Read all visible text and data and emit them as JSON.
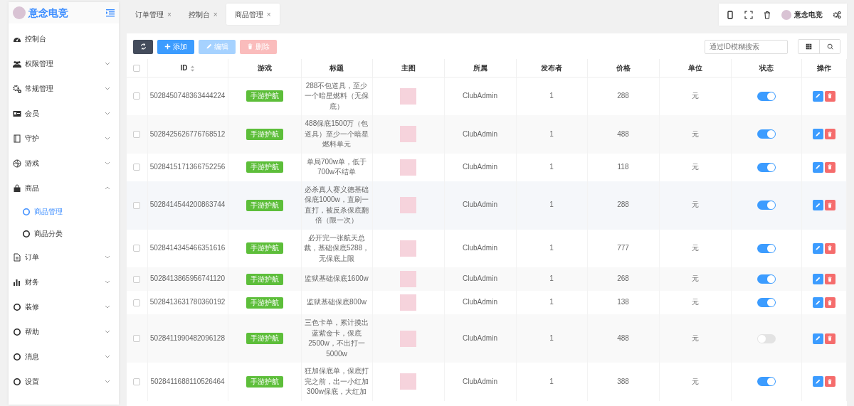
{
  "sidebar": {
    "logo": "意念电竞",
    "items": [
      {
        "label": "控制台"
      },
      {
        "label": "权限管理",
        "expanded": false
      },
      {
        "label": "常规管理",
        "expanded": false
      },
      {
        "label": "会员",
        "expanded": false
      },
      {
        "label": "守护",
        "expanded": false
      },
      {
        "label": "游戏",
        "expanded": false
      },
      {
        "label": "商品",
        "expanded": true,
        "children": [
          {
            "label": "商品管理",
            "selected": true
          },
          {
            "label": "商品分类",
            "selected": false
          }
        ]
      },
      {
        "label": "订单",
        "expanded": false
      },
      {
        "label": "财务",
        "expanded": false
      },
      {
        "label": "装修",
        "expanded": false
      },
      {
        "label": "帮助",
        "expanded": false
      },
      {
        "label": "消息",
        "expanded": false
      },
      {
        "label": "设置",
        "expanded": false
      }
    ]
  },
  "tabs": [
    {
      "label": "订单管理",
      "close": "×",
      "selected": false
    },
    {
      "label": "控制台",
      "close": "×",
      "selected": false
    },
    {
      "label": "商品管理",
      "close": "×",
      "selected": true
    }
  ],
  "header": {
    "user": "意念电竞"
  },
  "toolbar": {
    "buttons": [
      {
        "kind": "refresh",
        "disabled": false
      },
      {
        "kind": "add",
        "label": "添加",
        "disabled": false
      },
      {
        "kind": "edit",
        "label": "编辑",
        "disabled": true
      },
      {
        "kind": "delete",
        "label": "删除",
        "disabled": true
      }
    ],
    "search": {
      "placeholder": "通过ID模糊搜索"
    }
  },
  "table": {
    "select_all_checked": false,
    "columns": [
      {
        "label": "ID",
        "sortable": true
      },
      {
        "label": "游戏"
      },
      {
        "label": "标题"
      },
      {
        "label": "主图"
      },
      {
        "label": "所属"
      },
      {
        "label": "发布者"
      },
      {
        "label": "价格"
      },
      {
        "label": "单位"
      },
      {
        "label": "状态"
      },
      {
        "label": "操作"
      }
    ],
    "rows": [
      {
        "checked": false,
        "id": "5028450748363444224",
        "game": "手游护航",
        "title": "288不包道具，至少一个暗星燃料（无保底）",
        "owner": "ClubAdmin",
        "publisher": "1",
        "price": "288",
        "unit": "元",
        "on": true
      },
      {
        "checked": false,
        "id": "5028425626776768512",
        "game": "手游护航",
        "title": "488保底1500万（包道具）至少一个暗星燃料单元",
        "owner": "ClubAdmin",
        "publisher": "1",
        "price": "488",
        "unit": "元",
        "on": true
      },
      {
        "checked": false,
        "id": "5028415171366752256",
        "game": "手游护航",
        "title": "单局700w单，低于700w不结单",
        "owner": "ClubAdmin",
        "publisher": "1",
        "price": "118",
        "unit": "元",
        "on": true
      },
      {
        "checked": false,
        "id": "5028414544200863744",
        "game": "手游护航",
        "title": "必杀真人赛义德基础保底1000w，直刷一直打，被反杀保底翻倍（限一次）",
        "owner": "ClubAdmin",
        "publisher": "1",
        "price": "288",
        "unit": "元",
        "on": true
      },
      {
        "checked": false,
        "id": "5028414345466351616",
        "game": "手游护航",
        "title": "必开完一张航天总裁，基础保底5288，无保底上限",
        "owner": "ClubAdmin",
        "publisher": "1",
        "price": "777",
        "unit": "元",
        "on": true
      },
      {
        "checked": false,
        "id": "5028413865956741120",
        "game": "手游护航",
        "title": "监狱基础保底1600w",
        "owner": "ClubAdmin",
        "publisher": "1",
        "price": "268",
        "unit": "元",
        "on": true
      },
      {
        "checked": false,
        "id": "5028413631780360192",
        "game": "手游护航",
        "title": "监狱基础保底800w",
        "owner": "ClubAdmin",
        "publisher": "1",
        "price": "138",
        "unit": "元",
        "on": true
      },
      {
        "checked": false,
        "id": "5028411990482096128",
        "game": "手游护航",
        "title": "三色卡单，累计摸出蓝紫金卡，保底2500w，不出打一5000w",
        "owner": "ClubAdmin",
        "publisher": "1",
        "price": "488",
        "unit": "元",
        "on": false
      },
      {
        "checked": false,
        "id": "5028411688110526464",
        "game": "手游护航",
        "title": "狂加保底单，保底打完之前，出一小红加300w保底，大红加",
        "owner": "ClubAdmin",
        "publisher": "1",
        "price": "388",
        "unit": "元",
        "on": true
      }
    ]
  }
}
